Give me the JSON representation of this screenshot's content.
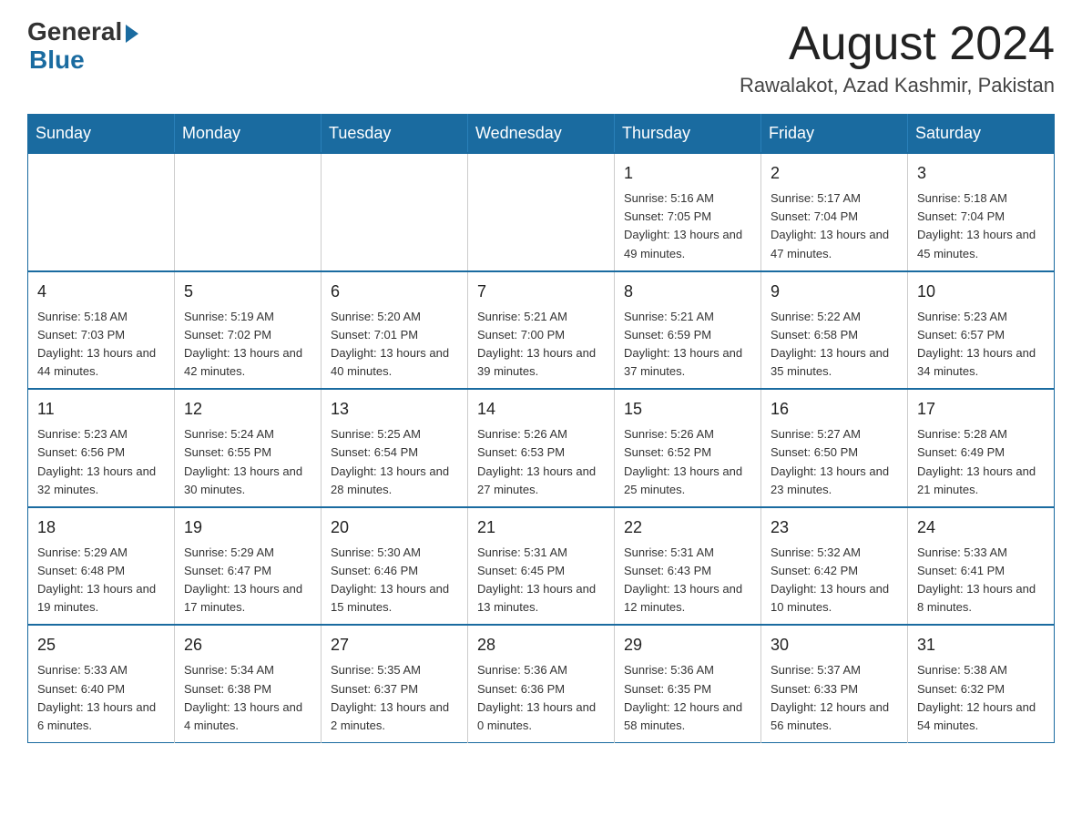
{
  "header": {
    "logo_general": "General",
    "logo_blue": "Blue",
    "month_title": "August 2024",
    "location": "Rawalakot, Azad Kashmir, Pakistan"
  },
  "weekdays": [
    "Sunday",
    "Monday",
    "Tuesday",
    "Wednesday",
    "Thursday",
    "Friday",
    "Saturday"
  ],
  "weeks": [
    [
      {
        "day": "",
        "info": ""
      },
      {
        "day": "",
        "info": ""
      },
      {
        "day": "",
        "info": ""
      },
      {
        "day": "",
        "info": ""
      },
      {
        "day": "1",
        "info": "Sunrise: 5:16 AM\nSunset: 7:05 PM\nDaylight: 13 hours\nand 49 minutes."
      },
      {
        "day": "2",
        "info": "Sunrise: 5:17 AM\nSunset: 7:04 PM\nDaylight: 13 hours\nand 47 minutes."
      },
      {
        "day": "3",
        "info": "Sunrise: 5:18 AM\nSunset: 7:04 PM\nDaylight: 13 hours\nand 45 minutes."
      }
    ],
    [
      {
        "day": "4",
        "info": "Sunrise: 5:18 AM\nSunset: 7:03 PM\nDaylight: 13 hours\nand 44 minutes."
      },
      {
        "day": "5",
        "info": "Sunrise: 5:19 AM\nSunset: 7:02 PM\nDaylight: 13 hours\nand 42 minutes."
      },
      {
        "day": "6",
        "info": "Sunrise: 5:20 AM\nSunset: 7:01 PM\nDaylight: 13 hours\nand 40 minutes."
      },
      {
        "day": "7",
        "info": "Sunrise: 5:21 AM\nSunset: 7:00 PM\nDaylight: 13 hours\nand 39 minutes."
      },
      {
        "day": "8",
        "info": "Sunrise: 5:21 AM\nSunset: 6:59 PM\nDaylight: 13 hours\nand 37 minutes."
      },
      {
        "day": "9",
        "info": "Sunrise: 5:22 AM\nSunset: 6:58 PM\nDaylight: 13 hours\nand 35 minutes."
      },
      {
        "day": "10",
        "info": "Sunrise: 5:23 AM\nSunset: 6:57 PM\nDaylight: 13 hours\nand 34 minutes."
      }
    ],
    [
      {
        "day": "11",
        "info": "Sunrise: 5:23 AM\nSunset: 6:56 PM\nDaylight: 13 hours\nand 32 minutes."
      },
      {
        "day": "12",
        "info": "Sunrise: 5:24 AM\nSunset: 6:55 PM\nDaylight: 13 hours\nand 30 minutes."
      },
      {
        "day": "13",
        "info": "Sunrise: 5:25 AM\nSunset: 6:54 PM\nDaylight: 13 hours\nand 28 minutes."
      },
      {
        "day": "14",
        "info": "Sunrise: 5:26 AM\nSunset: 6:53 PM\nDaylight: 13 hours\nand 27 minutes."
      },
      {
        "day": "15",
        "info": "Sunrise: 5:26 AM\nSunset: 6:52 PM\nDaylight: 13 hours\nand 25 minutes."
      },
      {
        "day": "16",
        "info": "Sunrise: 5:27 AM\nSunset: 6:50 PM\nDaylight: 13 hours\nand 23 minutes."
      },
      {
        "day": "17",
        "info": "Sunrise: 5:28 AM\nSunset: 6:49 PM\nDaylight: 13 hours\nand 21 minutes."
      }
    ],
    [
      {
        "day": "18",
        "info": "Sunrise: 5:29 AM\nSunset: 6:48 PM\nDaylight: 13 hours\nand 19 minutes."
      },
      {
        "day": "19",
        "info": "Sunrise: 5:29 AM\nSunset: 6:47 PM\nDaylight: 13 hours\nand 17 minutes."
      },
      {
        "day": "20",
        "info": "Sunrise: 5:30 AM\nSunset: 6:46 PM\nDaylight: 13 hours\nand 15 minutes."
      },
      {
        "day": "21",
        "info": "Sunrise: 5:31 AM\nSunset: 6:45 PM\nDaylight: 13 hours\nand 13 minutes."
      },
      {
        "day": "22",
        "info": "Sunrise: 5:31 AM\nSunset: 6:43 PM\nDaylight: 13 hours\nand 12 minutes."
      },
      {
        "day": "23",
        "info": "Sunrise: 5:32 AM\nSunset: 6:42 PM\nDaylight: 13 hours\nand 10 minutes."
      },
      {
        "day": "24",
        "info": "Sunrise: 5:33 AM\nSunset: 6:41 PM\nDaylight: 13 hours\nand 8 minutes."
      }
    ],
    [
      {
        "day": "25",
        "info": "Sunrise: 5:33 AM\nSunset: 6:40 PM\nDaylight: 13 hours\nand 6 minutes."
      },
      {
        "day": "26",
        "info": "Sunrise: 5:34 AM\nSunset: 6:38 PM\nDaylight: 13 hours\nand 4 minutes."
      },
      {
        "day": "27",
        "info": "Sunrise: 5:35 AM\nSunset: 6:37 PM\nDaylight: 13 hours\nand 2 minutes."
      },
      {
        "day": "28",
        "info": "Sunrise: 5:36 AM\nSunset: 6:36 PM\nDaylight: 13 hours\nand 0 minutes."
      },
      {
        "day": "29",
        "info": "Sunrise: 5:36 AM\nSunset: 6:35 PM\nDaylight: 12 hours\nand 58 minutes."
      },
      {
        "day": "30",
        "info": "Sunrise: 5:37 AM\nSunset: 6:33 PM\nDaylight: 12 hours\nand 56 minutes."
      },
      {
        "day": "31",
        "info": "Sunrise: 5:38 AM\nSunset: 6:32 PM\nDaylight: 12 hours\nand 54 minutes."
      }
    ]
  ]
}
